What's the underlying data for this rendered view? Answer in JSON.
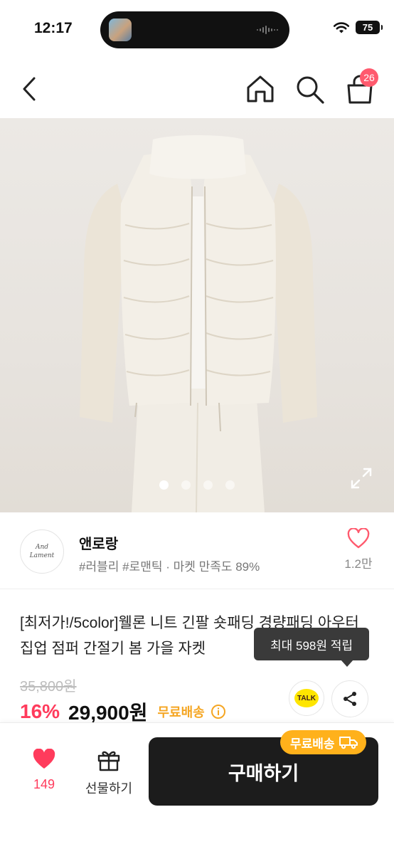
{
  "status_bar": {
    "time": "12:17",
    "battery": "75"
  },
  "header": {
    "cart_count": "26"
  },
  "gallery": {
    "pages": 4,
    "active_page": 1
  },
  "store": {
    "logo_text_line1": "And",
    "logo_text_line2": "Lament",
    "name": "앤로랑",
    "tags": "#러블리 #로맨틱 · 마켓 만족도 89%",
    "likes": "1.2만"
  },
  "product": {
    "title": "[최저가!/5color]웰론 니트 긴팔 숏패딩 경량패딩 아우터 집업 점퍼 간절기 봄 가을 자켓",
    "original_price": "35,800원",
    "discount": "16%",
    "price": "29,900원",
    "shipping": "무료배송",
    "points_tooltip": "최대 598원 적립",
    "talk_label": "TALK"
  },
  "bottom_bar": {
    "wish_count": "149",
    "gift_label": "선물하기",
    "buy_label": "구매하기",
    "shipping_badge": "무료배송"
  },
  "colors": {
    "accent_pink": "#ff3b5c",
    "shipping_orange": "#f5a623",
    "badge_orange": "#ffb11b",
    "buy_black": "#1c1c1c",
    "kakao_yellow": "#fee500"
  }
}
